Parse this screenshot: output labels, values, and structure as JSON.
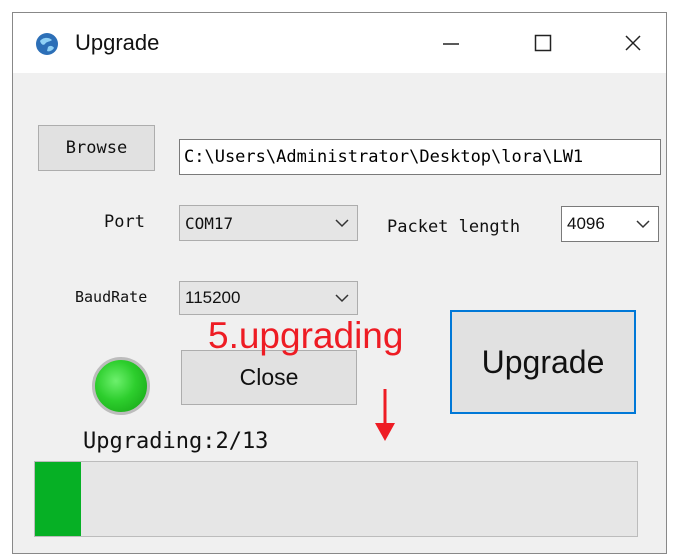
{
  "window": {
    "title": "Upgrade",
    "icons": {
      "app": "globe-icon",
      "minimize": "minimize-icon",
      "maximize": "maximize-icon",
      "close": "close-icon"
    }
  },
  "file": {
    "browse_label": "Browse",
    "path_value": "C:\\Users\\Administrator\\Desktop\\lora\\LW1"
  },
  "port": {
    "label": "Port",
    "selected": "COM17"
  },
  "packet": {
    "label": "Packet length",
    "selected": "4096"
  },
  "baud": {
    "label": "BaudRate",
    "selected": "115200"
  },
  "actions": {
    "close_label": "Close",
    "upgrade_label": "Upgrade"
  },
  "annotation": {
    "text": "5.upgrading"
  },
  "status": {
    "text": "Upgrading:2/13",
    "progress_fraction": 0.0769
  },
  "colors": {
    "accent_border": "#0078d7",
    "progress": "#06b025",
    "led": "#2dce2d",
    "annotation": "#ee1c24"
  }
}
